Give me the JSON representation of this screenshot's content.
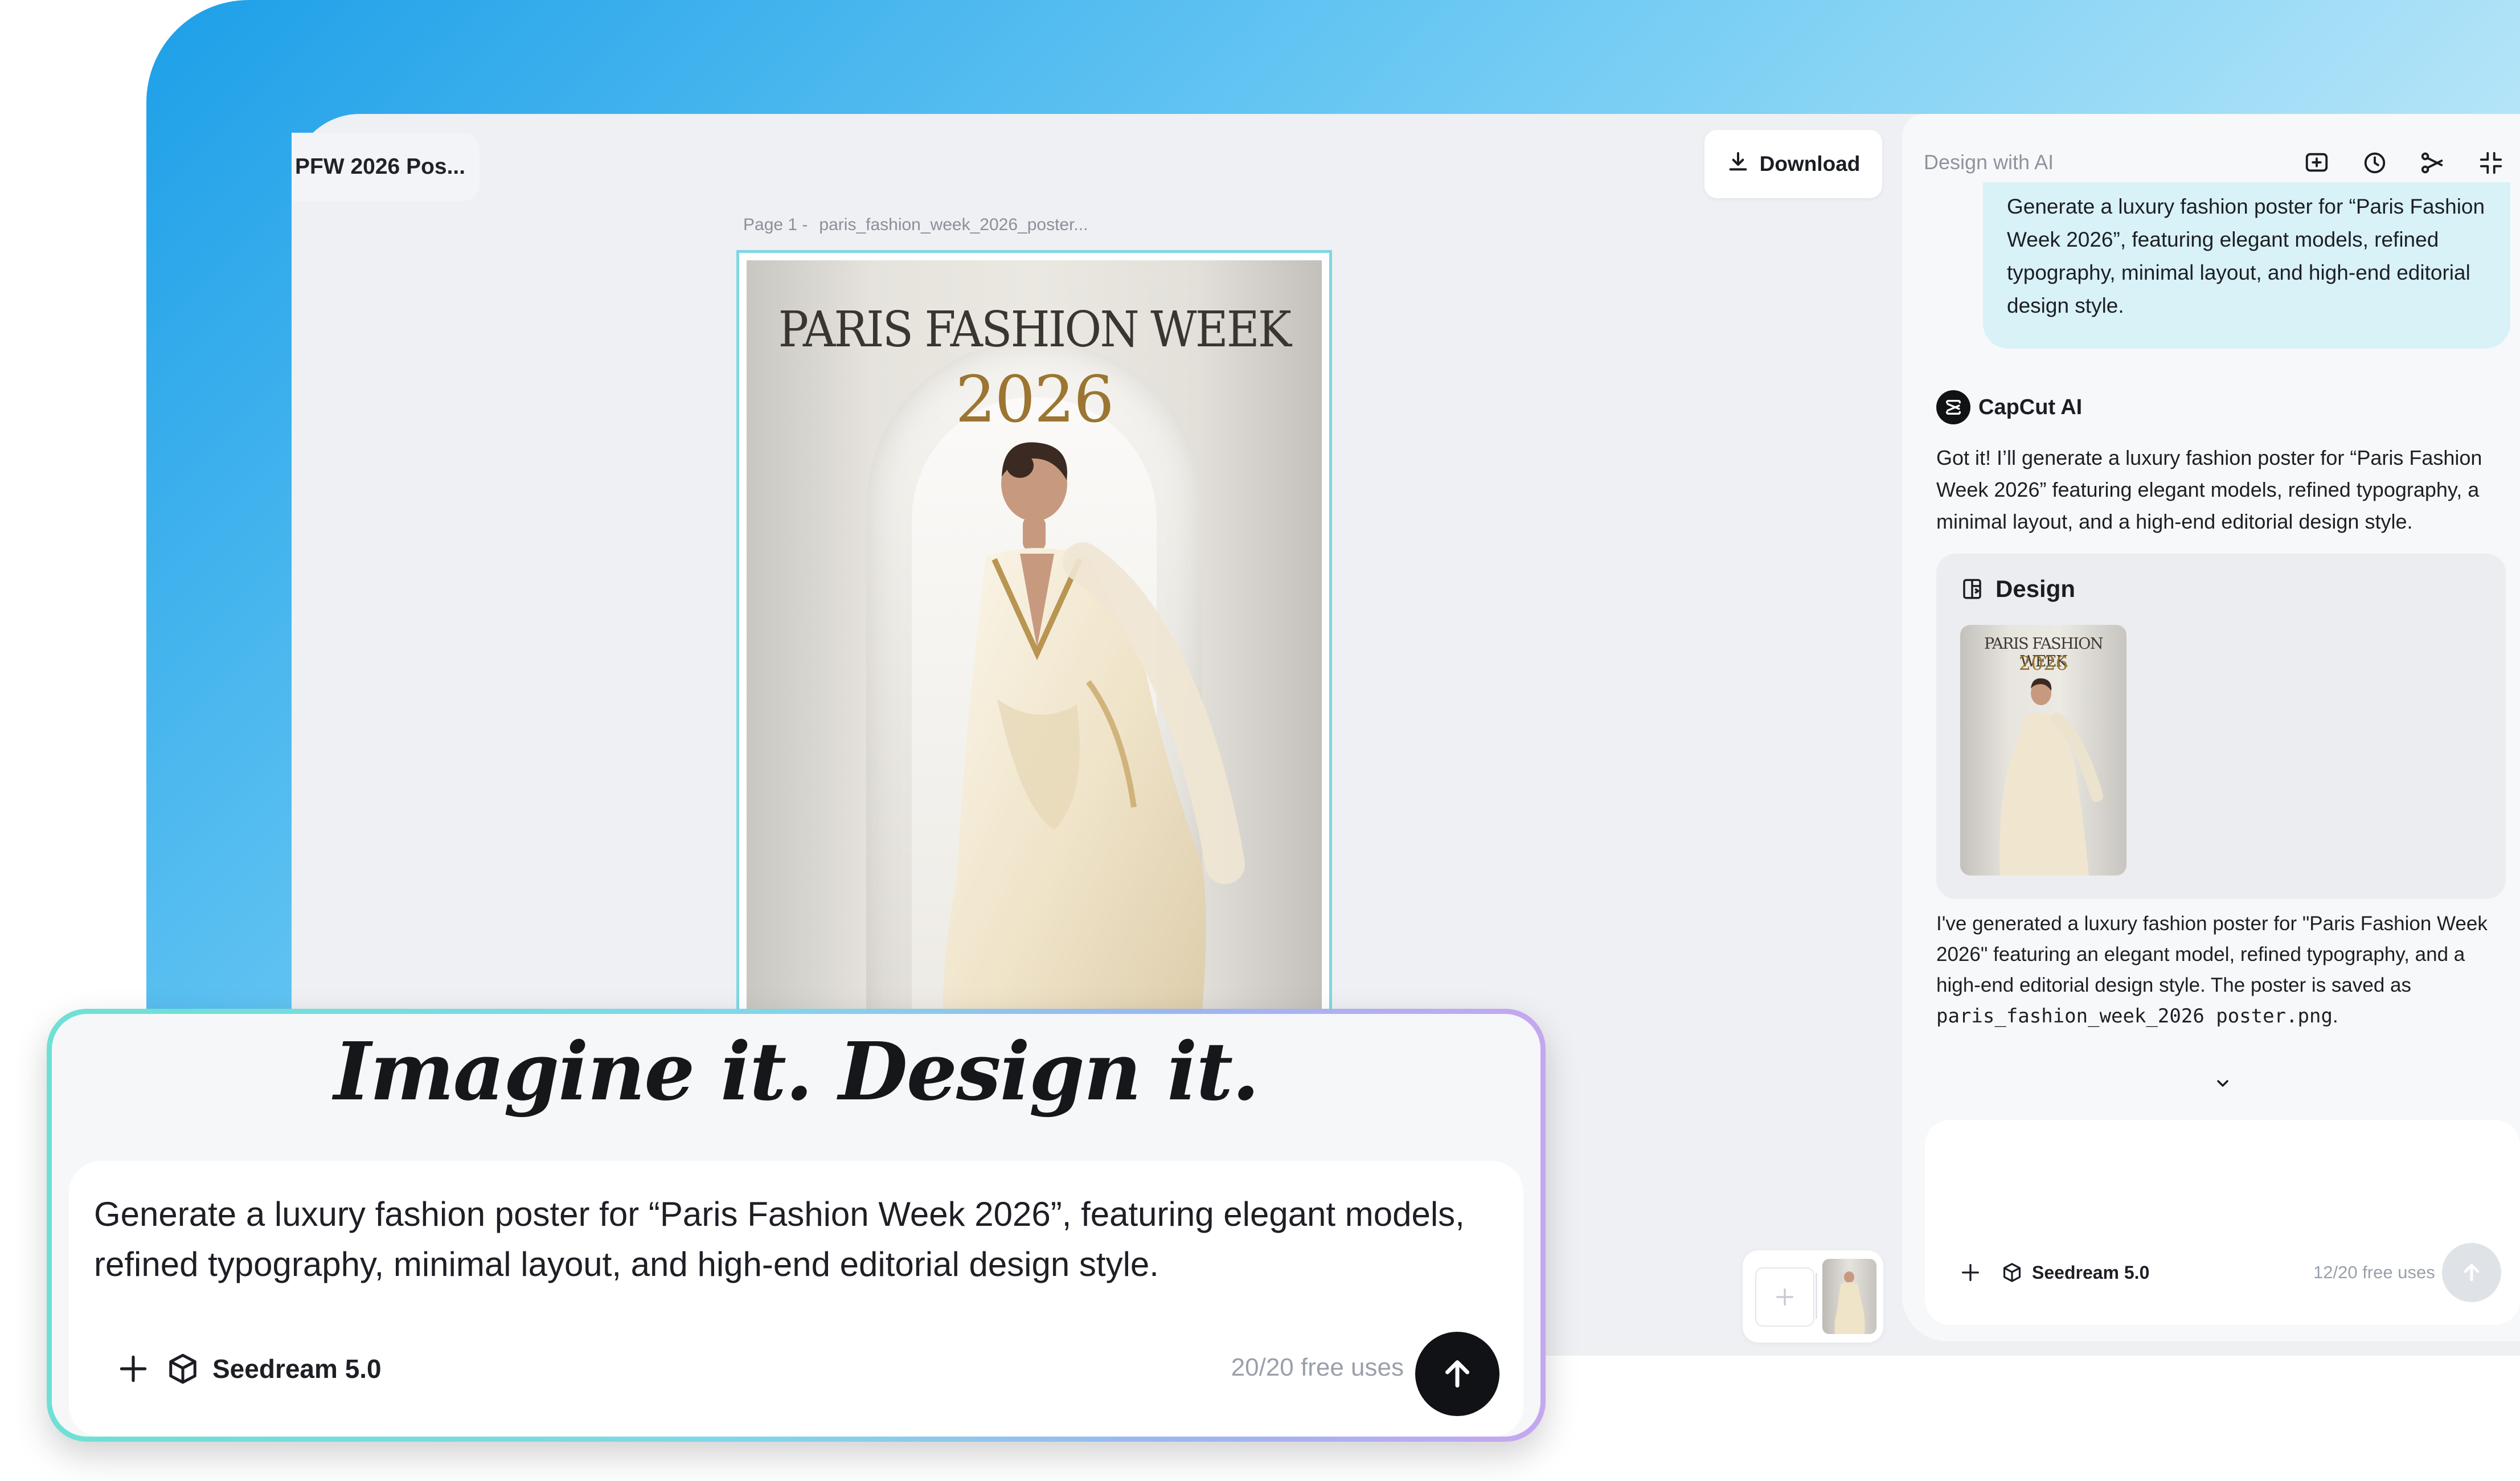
{
  "document": {
    "title": "PFW 2026 Pos..."
  },
  "toolbar": {
    "download_label": "Download"
  },
  "canvas": {
    "page_label": "Page 1 -",
    "page_filename": "paris_fashion_week_2026_poster...",
    "poster": {
      "headline": "PARIS FASHION WEEK",
      "year": "2026"
    }
  },
  "composer": {
    "slogan": "Imagine it. Design it.",
    "prompt": "Generate a luxury fashion poster for “Paris Fashion Week 2026”, featuring elegant models, refined typography, minimal layout, and high-end editorial design style.",
    "model": "Seedream 5.0",
    "free_uses": "20/20 free uses"
  },
  "panel": {
    "title": "Design with AI",
    "icons": [
      "new-chat-icon",
      "history-icon",
      "share-icon",
      "collapse-icon"
    ],
    "user_message": "Generate a luxury fashion poster for “Paris Fashion Week 2026”, featuring elegant models, refined typography, minimal layout, and high-end editorial design style.",
    "assistant_name": "CapCut AI",
    "assistant_reply": "Got it! I’ll generate a luxury fashion poster for “Paris Fashion Week 2026” featuring elegant models, refined typography, a minimal layout, and a high-end editorial design style.",
    "design_card": {
      "title": "Design",
      "thumb_headline": "PARIS FASHION WEEK",
      "thumb_year": "2026"
    },
    "result_text": "I've generated a luxury fashion poster for \"Paris Fashion Week 2026\" featuring an elegant model, refined typography, and a high-end editorial design style. The poster is saved as",
    "result_filename": "paris_fashion_week_2026 poster.png",
    "result_end": ".",
    "input": {
      "model": "Seedream 5.0",
      "free_uses": "12/20 free uses"
    }
  },
  "colors": {
    "accent_gradient_start": "#1d9fe8",
    "composer_border": "#6fe0d4",
    "user_bubble": "#d8f2f7",
    "poster_gold": "#9b7531"
  }
}
